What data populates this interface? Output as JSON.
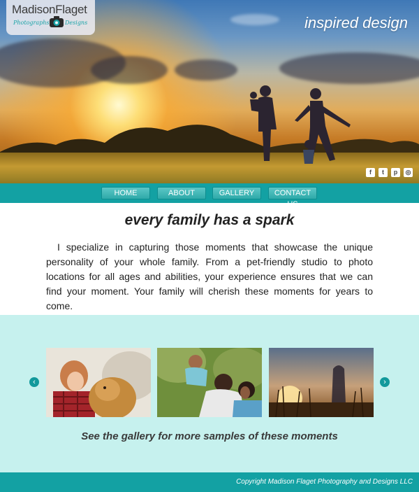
{
  "brand": {
    "name": "MadisonFlaget",
    "sub_left": "Photographs",
    "sub_right": "Designs",
    "tagline": "inspired design"
  },
  "social": [
    {
      "icon": "facebook-icon",
      "glyph": "f"
    },
    {
      "icon": "twitter-icon",
      "glyph": "t"
    },
    {
      "icon": "pinterest-icon",
      "glyph": "p"
    },
    {
      "icon": "instagram-icon",
      "glyph": "◎"
    }
  ],
  "nav": {
    "home": "HOME",
    "about": "ABOUT",
    "gallery": "GALLERY",
    "contact": "CONTACT US"
  },
  "intro": {
    "title": "every family has a spark",
    "body": "I specialize in capturing those moments that showcase the unique personality of your whole family. From a pet-friendly studio to photo locations for all ages and abilities, your experience ensures that we can find your moment. Your family will cherish these moments for years to come."
  },
  "gallery": {
    "prev_glyph": "‹",
    "next_glyph": "›",
    "caption": "See the gallery for more samples of these moments"
  },
  "footer": {
    "copyright": "Copyright Madison Flaget Photography and Designs LLC"
  },
  "colors": {
    "accent": "#13a1a3",
    "gallery_bg": "#c6f1ee"
  }
}
